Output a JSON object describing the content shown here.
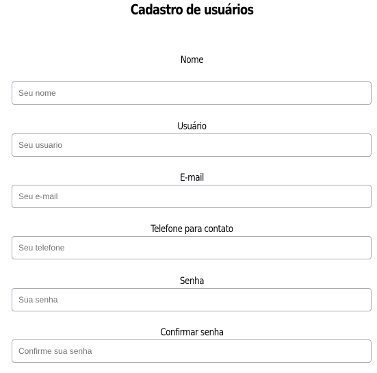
{
  "form": {
    "title": "Cadastro de usuários",
    "fields": [
      {
        "label": "Nome",
        "placeholder": "Seu nome",
        "value": ""
      },
      {
        "label": "Usuário",
        "placeholder": "Seu usuario",
        "value": ""
      },
      {
        "label": "E-mail",
        "placeholder": "Seu e-mail",
        "value": ""
      },
      {
        "label": "Telefone para contato",
        "placeholder": "Seu telefone",
        "value": ""
      },
      {
        "label": "Senha",
        "placeholder": "Sua senha",
        "value": ""
      },
      {
        "label": "Confirmar senha",
        "placeholder": "Confirme sua senha",
        "value": ""
      }
    ]
  }
}
